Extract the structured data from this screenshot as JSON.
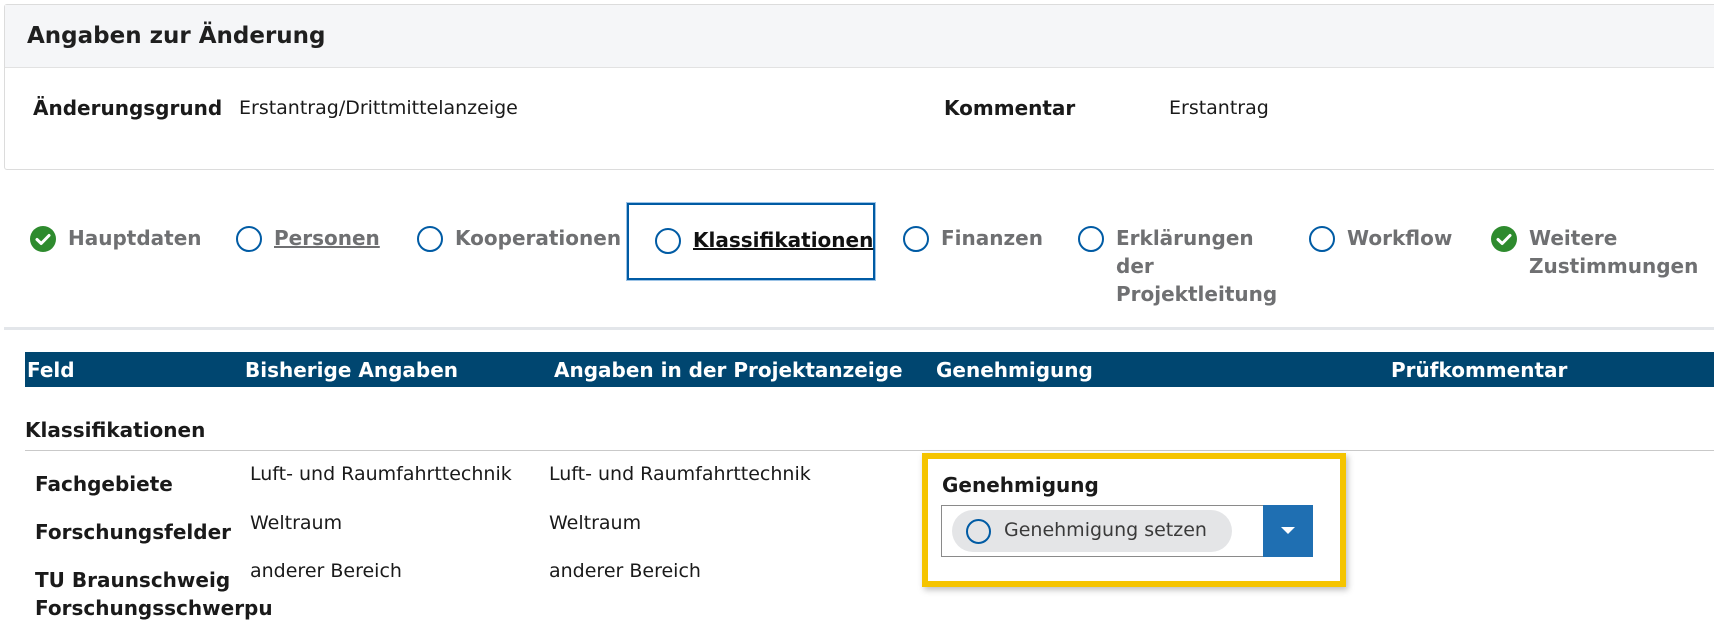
{
  "card": {
    "title": "Angaben zur Änderung",
    "reason_label": "Änderungsgrund",
    "reason_value": "Erstantrag/Drittmittelanzeige",
    "comment_label": "Kommentar",
    "comment_value": "Erstantrag"
  },
  "steps": [
    {
      "label": "Hauptdaten",
      "status": "complete",
      "icon": "check-circle-icon"
    },
    {
      "label": "Personen",
      "status": "open",
      "icon": "circle-icon"
    },
    {
      "label": "Kooperationen",
      "status": "open",
      "icon": "circle-icon"
    },
    {
      "label": "Klassifikationen",
      "status": "active",
      "icon": "circle-icon"
    },
    {
      "label": "Finanzen",
      "status": "open",
      "icon": "circle-icon"
    },
    {
      "label_lines": [
        "Erklärungen",
        "der",
        "Projektleitung"
      ],
      "status": "open",
      "icon": "circle-icon"
    },
    {
      "label": "Workflow",
      "status": "open",
      "icon": "circle-icon"
    },
    {
      "label_lines": [
        "Weitere",
        "Zustimmungen"
      ],
      "status": "complete",
      "icon": "check-circle-icon"
    }
  ],
  "table": {
    "headers": [
      "Feld",
      "Bisherige Angaben",
      "Angaben in der Projektanzeige",
      "Genehmigung",
      "Prüfkommentar"
    ],
    "section": "Klassifikationen",
    "rows": [
      {
        "field": "Fachgebiete",
        "previous": "Luft- und Raumfahrttechnik",
        "current": "Luft- und Raumfahrttechnik"
      },
      {
        "field": "Forschungsfelder",
        "previous": "Weltraum",
        "current": "Weltraum"
      },
      {
        "field_lines": [
          "TU Braunschweig",
          "Forschungsschwerpu"
        ],
        "previous": "anderer Bereich",
        "current": "anderer Bereich"
      }
    ]
  },
  "approval": {
    "label": "Genehmigung",
    "chip_text": "Genehmigung setzen",
    "icon": "circle-icon",
    "dropdown_icon": "chevron-down-icon"
  },
  "colors": {
    "header_bg": "#004670",
    "accent_blue": "#005ba4",
    "complete_green": "#2e8b2e",
    "highlight_yellow": "#f5c400",
    "dropdown_blue": "#1f6fb2"
  }
}
